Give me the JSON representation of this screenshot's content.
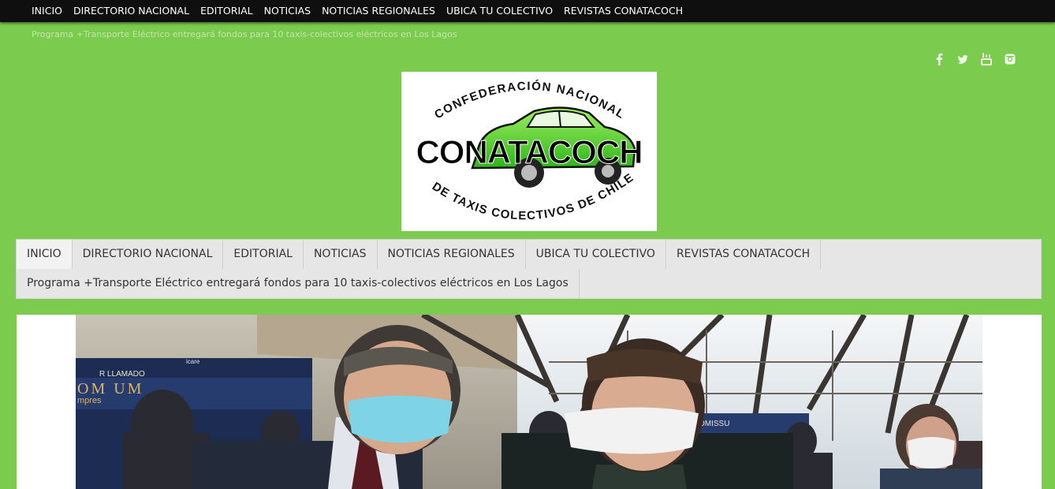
{
  "topbar": {
    "items": [
      "INICIO",
      "DIRECTORIO NACIONAL",
      "EDITORIAL",
      "NOTICIAS",
      "NOTICIAS REGIONALES",
      "UBICA TU COLECTIVO",
      "REVISTAS CONATACOCH"
    ],
    "subitem": "Programa +Transporte Eléctrico entregará fondos para 10 taxis-colectivos eléctricos en Los Lagos"
  },
  "social": {
    "icons": [
      "facebook-icon",
      "twitter-icon",
      "youtube-icon",
      "instagram-icon"
    ]
  },
  "logo": {
    "top_text": "CONFEDERACIÓN NACIONAL",
    "main_text": "CONATACOCH",
    "bottom_text": "DE TAXIS COLECTIVOS DE CHILE"
  },
  "mainnav": {
    "items": [
      "INICIO",
      "DIRECTORIO NACIONAL",
      "EDITORIAL",
      "NOTICIAS",
      "NOTICIAS REGIONALES",
      "UBICA TU COLECTIVO",
      "REVISTAS CONATACOCH"
    ],
    "subitem": "Programa +Transporte Eléctrico entregará fondos para 10 taxis-colectivos eléctricos en Los Lagos"
  },
  "photo": {
    "sign_left": "R LLAMADO",
    "sign_brand": "icare",
    "sign_big": "OM  UM",
    "sign_small": "mpres",
    "sign_right": "OMISSU"
  },
  "colors": {
    "page_bg": "#7bcb4f",
    "topbar_bg": "#0f0f0f",
    "nav_bg": "#e6e6e6",
    "logo_green": "#5bd62d"
  }
}
